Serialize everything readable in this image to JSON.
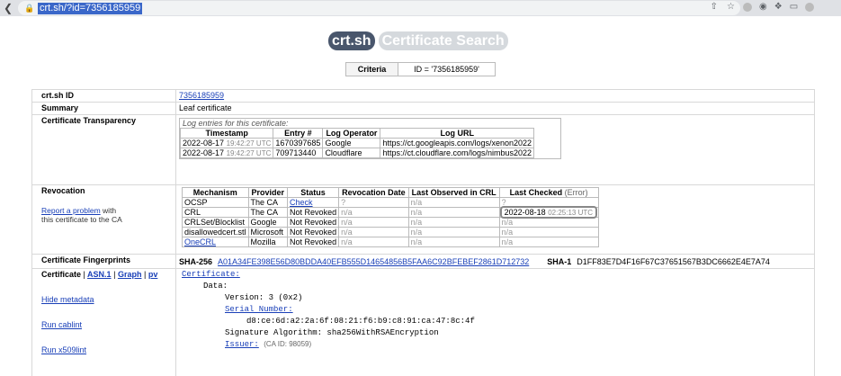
{
  "browser": {
    "url": "crt.sh/?id=7356185959"
  },
  "header": {
    "logo": "crt.sh",
    "logo_sub": "Certificate Search",
    "criteria_label": "Criteria",
    "criteria_value": "ID = '7356185959'"
  },
  "info": {
    "id_label": "crt.sh ID",
    "id_value": "7356185959",
    "summary_label": "Summary",
    "summary_value": "Leaf certificate",
    "ct_label": "Certificate Transparency",
    "ct_caption": "Log entries for this certificate:",
    "ct_headers": [
      "Timestamp",
      "Entry #",
      "Log Operator",
      "Log URL"
    ],
    "ct_rows": [
      {
        "date": "2022-08-17",
        "time": "19:42:27 UTC",
        "entry": "1670397685",
        "op": "Google",
        "url": "https://ct.googleapis.com/logs/xenon2022"
      },
      {
        "date": "2022-08-17",
        "time": "19:42:27 UTC",
        "entry": "709713440",
        "op": "Cloudflare",
        "url": "https://ct.cloudflare.com/logs/nimbus2022"
      }
    ]
  },
  "revocation": {
    "label": "Revocation",
    "report_link": "Report a problem",
    "report_text_1": "with",
    "report_text_2": "this certificate to the CA",
    "headers": [
      "Mechanism",
      "Provider",
      "Status",
      "Revocation Date",
      "Last Observed in CRL",
      "Last Checked"
    ],
    "error_label": "(Error)",
    "rows": [
      {
        "mech": "OCSP",
        "prov": "The CA",
        "status": "Check",
        "rdate": "?",
        "lastobs": "n/a",
        "lastchk": "?"
      },
      {
        "mech": "CRL",
        "prov": "The CA",
        "status": "Not Revoked",
        "rdate": "n/a",
        "lastobs": "n/a",
        "lastchk": "2022-08-18",
        "lastchk_time": "02:25:13 UTC"
      },
      {
        "mech": "CRLSet/Blocklist",
        "prov": "Google",
        "status": "Not Revoked",
        "rdate": "n/a",
        "lastobs": "n/a",
        "lastchk": "n/a"
      },
      {
        "mech": "disallowedcert.stl",
        "prov": "Microsoft",
        "status": "Not Revoked",
        "rdate": "n/a",
        "lastobs": "n/a",
        "lastchk": "n/a"
      },
      {
        "mech": "OneCRL",
        "prov": "Mozilla",
        "status": "Not Revoked",
        "rdate": "n/a",
        "lastobs": "n/a",
        "lastchk": "n/a"
      }
    ]
  },
  "fingerprints": {
    "label": "Certificate Fingerprints",
    "sha256_label": "SHA-256",
    "sha256": "A01A34FE398E56D80BDDA40EFB555D14654856B5FAA6C92BFEBEF2861D712732",
    "sha1_label": "SHA-1",
    "sha1": "D1FF83E7D4F16F67C37651567B3DC6662E4E7A74"
  },
  "certificate": {
    "label": "Certificate",
    "sep1": "|",
    "asn1": "ASN.1",
    "sep2": "|",
    "graph": "Graph",
    "sep3": "|",
    "pv": "pv",
    "hide_metadata": "Hide metadata",
    "run_cablint": "Run cablint",
    "run_x509lint": "Run x509lint",
    "lines": {
      "cert": "Certificate:",
      "data": "Data:",
      "version": "Version: 3 (0x2)",
      "serial_label": "Serial Number:",
      "serial": "d8:ce:6d:a2:2a:6f:08:21:f6:b9:c8:91:ca:47:8c:4f",
      "sigalg": "Signature Algorithm: sha256WithRSAEncryption",
      "issuer": "Issuer:",
      "issuer_caid": "(CA ID: 98059)"
    }
  }
}
